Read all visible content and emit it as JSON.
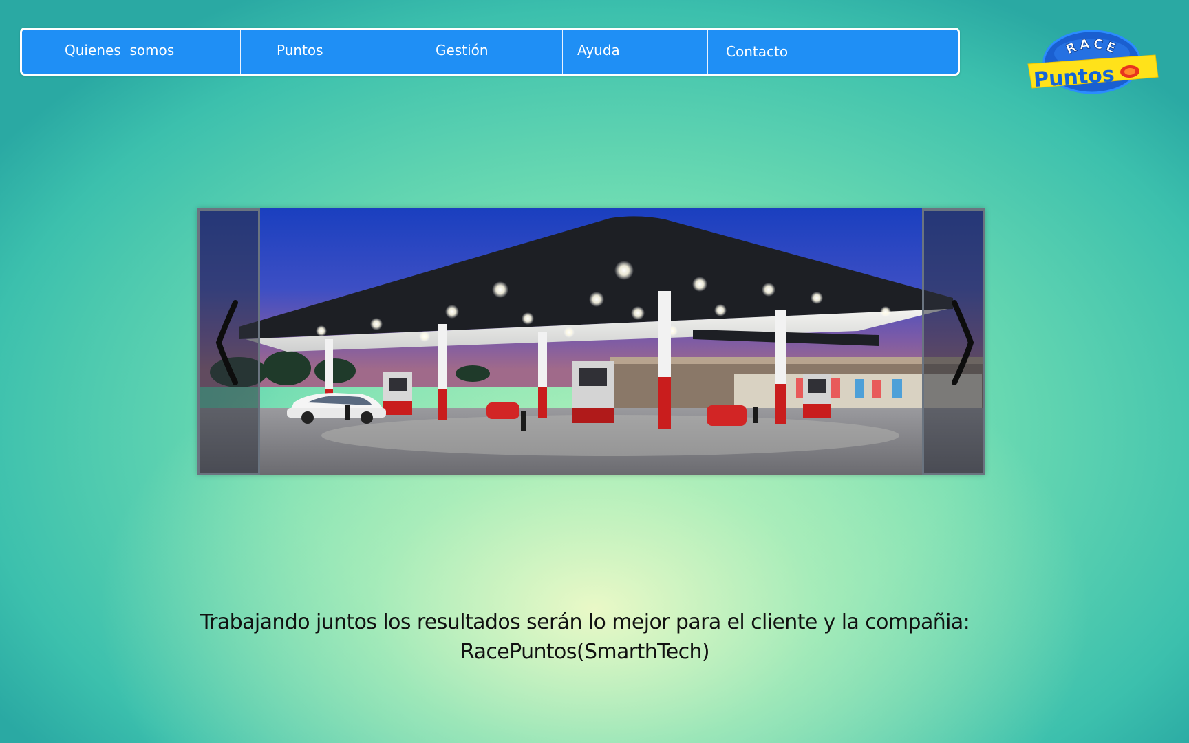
{
  "nav": {
    "items": [
      {
        "label": "Quienes  somos"
      },
      {
        "label": "Puntos"
      },
      {
        "label": "Gestión"
      },
      {
        "label": "Ayuda"
      },
      {
        "label": "Contacto"
      }
    ]
  },
  "logo": {
    "top_text": "RACE",
    "main_text": "Puntos"
  },
  "slider": {
    "prev_icon": "chevron-left-icon",
    "next_icon": "chevron-right-icon",
    "image_subject": "gas-station-at-dusk"
  },
  "tagline": {
    "line1": "Trabajando juntos los resultados serán lo mejor para el cliente y la compañia:",
    "line2": "RacePuntos(SmarthTech)"
  },
  "colors": {
    "nav_bg": "#1f8ff5",
    "nav_border": "#ffffff",
    "logo_blue": "#1565d8",
    "logo_yellow": "#ffe21a",
    "bg_teal": "#2aa9a3",
    "bg_center": "#f0fac8"
  }
}
